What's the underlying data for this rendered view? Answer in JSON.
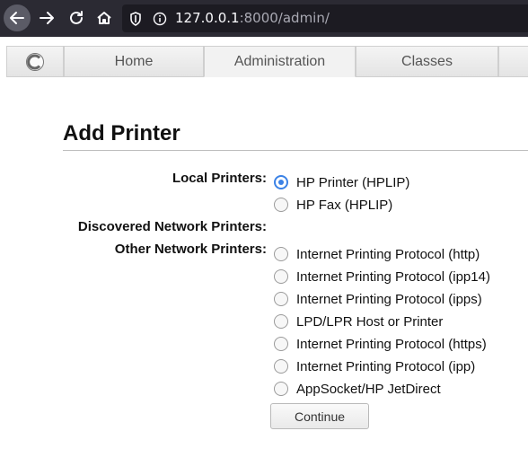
{
  "browser": {
    "url_host": "127.0.0.1",
    "url_rest": ":8000/admin/"
  },
  "tabs": [
    {
      "label": "Home"
    },
    {
      "label": "Administration"
    },
    {
      "label": "Classes"
    }
  ],
  "page": {
    "title": "Add Printer",
    "local_label": "Local Printers:",
    "discovered_label": "Discovered Network Printers:",
    "other_label": "Other Network Printers:",
    "local_options": [
      {
        "label": "HP Printer (HPLIP)",
        "checked": true
      },
      {
        "label": "HP Fax (HPLIP)",
        "checked": false
      }
    ],
    "other_options": [
      {
        "label": "Internet Printing Protocol (http)",
        "checked": false
      },
      {
        "label": "Internet Printing Protocol (ipp14)",
        "checked": false
      },
      {
        "label": "Internet Printing Protocol (ipps)",
        "checked": false
      },
      {
        "label": "LPD/LPR Host or Printer",
        "checked": false
      },
      {
        "label": "Internet Printing Protocol (https)",
        "checked": false
      },
      {
        "label": "Internet Printing Protocol (ipp)",
        "checked": false
      },
      {
        "label": "AppSocket/HP JetDirect",
        "checked": false
      }
    ],
    "continue_label": "Continue"
  }
}
